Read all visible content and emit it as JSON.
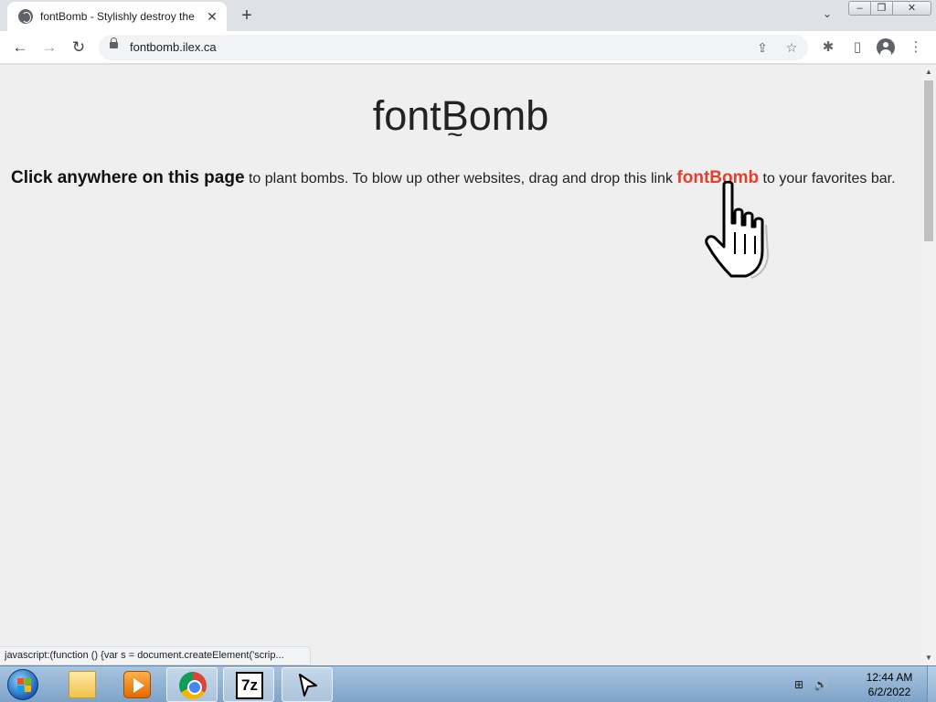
{
  "browser": {
    "tab_title": "fontBomb - Stylishly destroy the",
    "tab_close_glyph": "✕",
    "new_tab_glyph": "+",
    "tab_search_glyph": "⌄",
    "url": "fontbomb.ilex.ca",
    "back_glyph": "←",
    "forward_glyph": "→",
    "reload_glyph": "↻",
    "share_glyph": "⇪",
    "bookmark_glyph": "☆",
    "extensions_glyph": "✱",
    "sidepanel_glyph": "▯",
    "menu_glyph": "⋮"
  },
  "window_controls": {
    "minimize": "–",
    "maximize": "❐",
    "close": "✕"
  },
  "page": {
    "logo_pre": "font",
    "logo_b": "B",
    "logo_post": "omb",
    "instruction_strong": "Click anywhere on this page",
    "instruction_mid": " to plant bombs. To blow up other websites, drag and drop this link ",
    "bomb_link": "fontBomb",
    "instruction_end": " to your favorites bar."
  },
  "status_bubble": "javascript:(function () {var s = document.createElement('scrip...",
  "scrollbar": {
    "up": "▲",
    "down": "▼"
  },
  "taskbar": {
    "apps": [
      {
        "name": "Windows Explorer",
        "icon": "folder-icon"
      },
      {
        "name": "Windows Media Player",
        "icon": "media-player-icon"
      },
      {
        "name": "Google Chrome",
        "icon": "chrome-icon"
      },
      {
        "name": "7-Zip",
        "icon": "sevenzip-icon",
        "label": "7z"
      },
      {
        "name": "Cursor app",
        "icon": "arrow-cursor-icon"
      }
    ],
    "clock_time": "12:44 AM",
    "clock_date": "6/2/2022",
    "tray_network": "⊞",
    "tray_volume": "🔊"
  },
  "colors": {
    "bomb_link": "#e0402c",
    "page_bg": "#efefef",
    "taskbar": "#7ea3c8"
  }
}
